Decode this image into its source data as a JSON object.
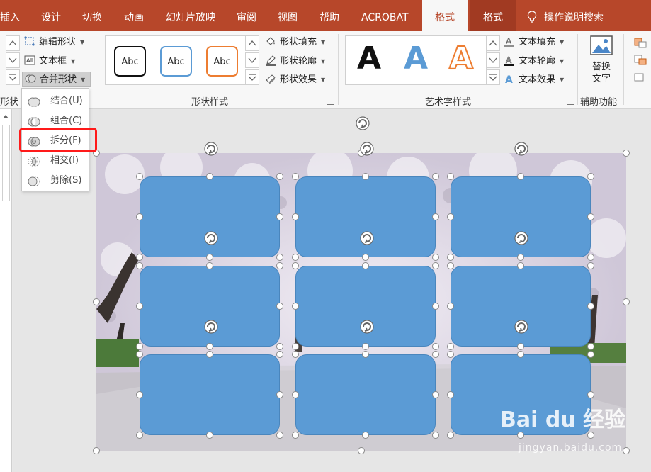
{
  "tabs": {
    "insert": "插入",
    "design": "设计",
    "transitions": "切换",
    "animations": "动画",
    "slideshow": "幻灯片放映",
    "review": "审阅",
    "view": "视图",
    "help": "帮助",
    "acrobat": "ACROBAT",
    "format_active": "格式",
    "format_other": "格式",
    "tell_me": "操作说明搜索"
  },
  "ribbon": {
    "insert_shapes": {
      "edit_shape": "编辑形状",
      "text_box": "文本框",
      "merge_shapes": "合并形状",
      "group_label_partial": "形状"
    },
    "shape_styles": {
      "presets": [
        "Abc",
        "Abc",
        "Abc"
      ],
      "fill": "形状填充",
      "outline": "形状轮廓",
      "effects": "形状效果",
      "group_label": "形状样式"
    },
    "wordart_styles": {
      "presets": [
        "A",
        "A",
        "A"
      ],
      "text_fill": "文本填充",
      "text_outline": "文本轮廓",
      "text_effects": "文本效果",
      "group_label": "艺术字样式"
    },
    "accessibility": {
      "alt_text_line1": "替换",
      "alt_text_line2": "文字",
      "group_label": "辅助功能"
    }
  },
  "merge_menu": {
    "items": [
      {
        "label": "结合(U)",
        "enabled": true
      },
      {
        "label": "组合(C)",
        "enabled": true
      },
      {
        "label": "拆分(F)",
        "enabled": true,
        "highlighted": true
      },
      {
        "label": "相交(I)",
        "enabled": true
      },
      {
        "label": "剪除(S)",
        "enabled": true
      }
    ]
  },
  "canvas": {
    "rounded_rect_count": 9,
    "shape_fill": "#5b9bd5"
  },
  "watermark": {
    "brand": "Bai du 经验",
    "url": "jingyan.baidu.com"
  },
  "colors": {
    "tab_bar": "#b7472a",
    "highlight_box": "#ff1a1a",
    "wordart_black": "#111111",
    "wordart_blue": "#5b9bd5",
    "wordart_orange": "#ed7d31"
  }
}
